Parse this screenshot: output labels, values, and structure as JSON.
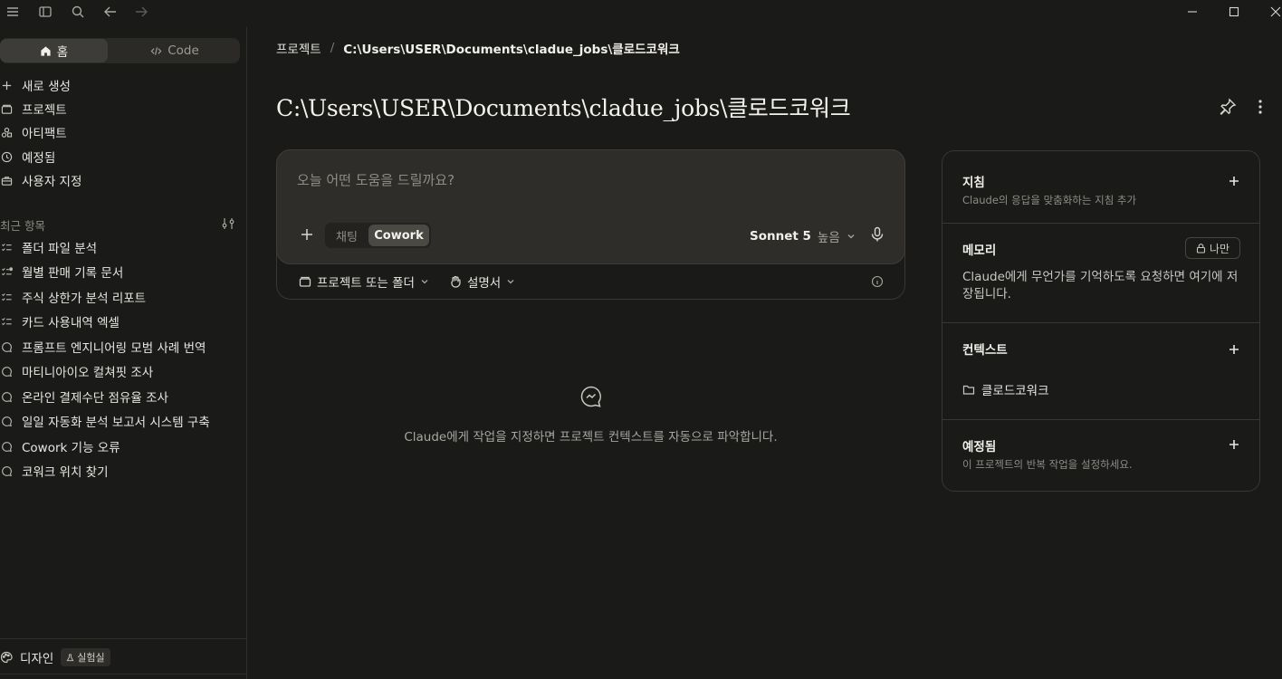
{
  "sidebar": {
    "mode_home": "홈",
    "mode_code": "Code",
    "nav": [
      {
        "label": "새로 생성",
        "icon": "plus-icon"
      },
      {
        "label": "프로젝트",
        "icon": "folder-icon"
      },
      {
        "label": "아티팩트",
        "icon": "artifact-icon"
      },
      {
        "label": "예정됨",
        "icon": "clock-icon"
      },
      {
        "label": "사용자 지정",
        "icon": "briefcase-icon"
      }
    ],
    "recent_label": "최근 항목",
    "recent": [
      {
        "label": "폴더 파일 분석",
        "icon": "task-icon"
      },
      {
        "label": "월별 판매 기록 문서",
        "icon": "task-icon"
      },
      {
        "label": "주식 상한가 분석 리포트",
        "icon": "task-icon"
      },
      {
        "label": "카드 사용내역 엑셀",
        "icon": "task-icon"
      },
      {
        "label": "프롬프트 엔지니어링 모범 사례 번역",
        "icon": "chat-bubble-icon"
      },
      {
        "label": "마티니아이오 컬쳐핏 조사",
        "icon": "chat-bubble-icon"
      },
      {
        "label": "온라인 결제수단 점유율 조사",
        "icon": "chat-bubble-icon"
      },
      {
        "label": "일일 자동화 분석 보고서 시스템 구축",
        "icon": "chat-bubble-icon"
      },
      {
        "label": "Cowork 기능 오류",
        "icon": "chat-bubble-icon"
      },
      {
        "label": "코워크 위치 찾기",
        "icon": "chat-bubble-icon"
      }
    ],
    "design_label": "디자인",
    "lab_badge": "실험실"
  },
  "breadcrumb": {
    "root": "프로젝트",
    "separator": "/",
    "current": "C:\\Users\\USER\\Documents\\cladue_jobs\\클로드코워크"
  },
  "page_title": "C:\\Users\\USER\\Documents\\cladue_jobs\\클로드코워크",
  "composer": {
    "placeholder": "오늘 어떤 도움을 드릴까요?",
    "tab_chat": "채팅",
    "tab_cowork": "Cowork",
    "model_name": "Sonnet 5",
    "model_level": "높음",
    "folder_label": "프로젝트 또는 폴더",
    "instructions_label": "설명서"
  },
  "empty_state": "Claude에게 작업을 지정하면 프로젝트 컨텍스트를 자동으로 파악합니다.",
  "panel": {
    "instructions_title": "지침",
    "instructions_sub": "Claude의 응답을 맞춤화하는 지침 추가",
    "memory_title": "메모리",
    "memory_private": "나만",
    "memory_body": "Claude에게 무언가를 기억하도록 요청하면 여기에 저장됩니다.",
    "context_title": "컨텍스트",
    "context_item": "클로드코워크",
    "scheduled_title": "예정됨",
    "scheduled_sub": "이 프로젝트의 반복 작업을 설정하세요."
  }
}
